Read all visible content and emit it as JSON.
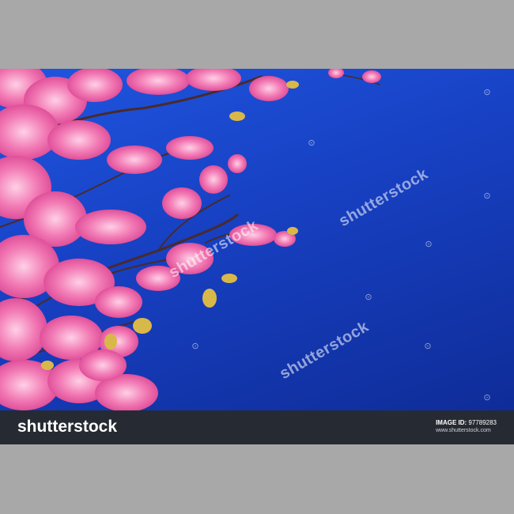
{
  "photo": {
    "subject": "",
    "watermark_text": "shutterstock",
    "sky_color": "#1a48d2",
    "blossom_color": "#f06aa8"
  },
  "footer": {
    "brand": "shutterstock",
    "image_id_label": "IMAGE ID:",
    "image_id": "97789283",
    "site": "www.shutterstock.com"
  }
}
